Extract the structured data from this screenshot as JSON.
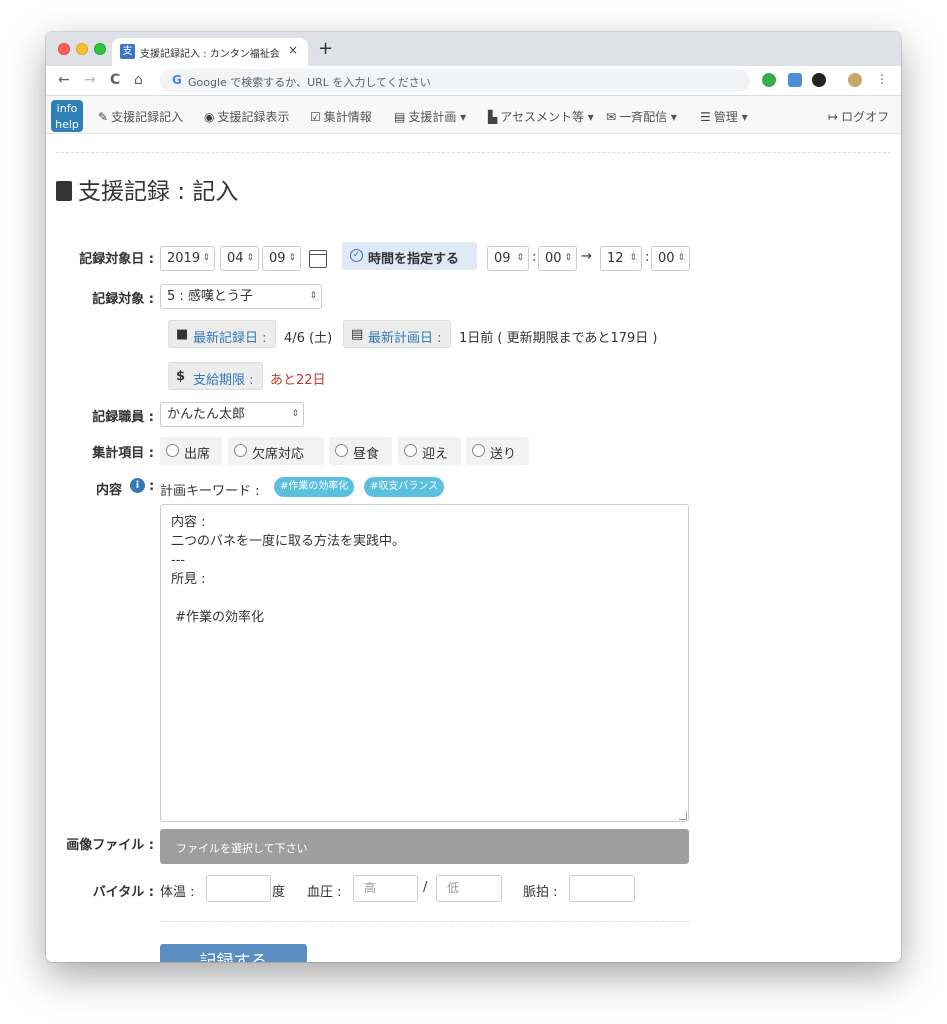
{
  "browser": {
    "tab_favicon": "支",
    "tab_title": "支援記録記入 : カンタン福祉会",
    "tab_close": "×",
    "new_tab": "+",
    "back": "←",
    "forward": "→",
    "reload": "C",
    "home": "⌂",
    "omnibox_g": "G",
    "omnibox_placeholder": "Google で検索するか、URL を入力してください"
  },
  "navbar": {
    "logo_line1": "info",
    "logo_line2": "help",
    "items": [
      {
        "icon": "✎",
        "label": "支援記録記入"
      },
      {
        "icon": "◉",
        "label": "支援記録表示"
      },
      {
        "icon": "☑",
        "label": "集計情報"
      },
      {
        "icon": "▤",
        "label": "支援計画 ▾"
      },
      {
        "icon": "▙",
        "label": "アセスメント等 ▾"
      },
      {
        "icon": "✉",
        "label": "一斉配信 ▾"
      },
      {
        "icon": "☰",
        "label": "管理 ▾"
      },
      {
        "icon": "↦",
        "label": "ログオフ"
      }
    ]
  },
  "page": {
    "title": "支援記録 : 記入"
  },
  "form": {
    "date_label": "記録対象日 :",
    "year": "2019",
    "month": "04",
    "day": "09",
    "time_toggle_label": "時間を指定する",
    "start_hour": "09",
    "start_min": "00",
    "arrow": "→",
    "end_hour": "12",
    "end_min": "00",
    "colon": ":",
    "subject_label": "記録対象 :",
    "subject_value": "5 : 感嘆とう子",
    "latest_record_label": "最新記録日 :",
    "latest_record_value": "4/6 (土)",
    "latest_plan_label": "最新計画日 :",
    "latest_plan_value": "1日前 ( 更新期限まであと179日 )",
    "supply_limit_icon": "$",
    "supply_limit_label": "支給期限 :",
    "supply_limit_value": "あと22日",
    "staff_label": "記録職員 :",
    "staff_value": "かんたん太郎",
    "tally_label": "集計項目 :",
    "tally_items": [
      "出席",
      "欠席対応",
      "昼食",
      "迎え",
      "送り"
    ],
    "content_label": "内容",
    "content_info_icon": "i",
    "content_colon": ":",
    "keyword_label": "計画キーワード :",
    "keywords": [
      "#作業の効率化",
      "#収支バランス"
    ],
    "content_text": "内容 :\n二つのバネを一度に取る方法を実践中。\n---\n所見 :\n\n #作業の効率化",
    "image_label": "画像ファイル :",
    "file_button": "ファイルを選択して下さい",
    "vital_label": "バイタル :",
    "temp_label": "体温 :",
    "temp_unit": "度",
    "bp_label": "血圧 :",
    "bp_high_placeholder": "高",
    "bp_sep": "/",
    "bp_low_placeholder": "低",
    "pulse_label": "脈拍 :",
    "submit_label": "記録する"
  }
}
